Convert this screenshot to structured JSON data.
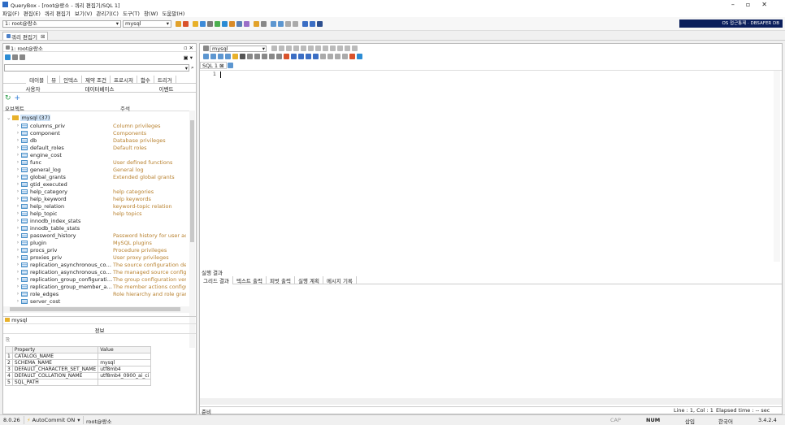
{
  "titlebar": {
    "title": "QueryBox - [root@랑소 - 쿼리 편집기/SQL 1]"
  },
  "menu": [
    "파일(F)",
    "편집(E)",
    "쿼리 편집기",
    "보기(V)",
    "관리기(C)",
    "도구(T)",
    "창(W)",
    "도움말(H)"
  ],
  "toolbar": {
    "connection": "1: root@랑소",
    "database": "mysql",
    "brand": "OS 접근통제 · DBSAFER DB"
  },
  "doc_tab": {
    "label": "쿼리 편집기"
  },
  "left": {
    "conn_label": "1: root@랑소",
    "tabs1": [
      "테이블",
      "뷰",
      "인덱스",
      "제약 조건",
      "프로시저",
      "함수",
      "트리거"
    ],
    "tabs2": [
      "사용자",
      "데이터베이스",
      "이벤트"
    ],
    "col_object": "오브젝트",
    "col_comment": "주석",
    "db_node": "mysql (37)",
    "tables": [
      {
        "name": "columns_priv",
        "comment": "Column privileges"
      },
      {
        "name": "component",
        "comment": "Components"
      },
      {
        "name": "db",
        "comment": "Database privileges"
      },
      {
        "name": "default_roles",
        "comment": "Default roles"
      },
      {
        "name": "engine_cost",
        "comment": ""
      },
      {
        "name": "func",
        "comment": "User defined functions"
      },
      {
        "name": "general_log",
        "comment": "General log"
      },
      {
        "name": "global_grants",
        "comment": "Extended global grants"
      },
      {
        "name": "gtid_executed",
        "comment": ""
      },
      {
        "name": "help_category",
        "comment": "help categories"
      },
      {
        "name": "help_keyword",
        "comment": "help keywords"
      },
      {
        "name": "help_relation",
        "comment": "keyword-topic relation"
      },
      {
        "name": "help_topic",
        "comment": "help topics"
      },
      {
        "name": "innodb_index_stats",
        "comment": ""
      },
      {
        "name": "innodb_table_stats",
        "comment": ""
      },
      {
        "name": "password_history",
        "comment": "Password history for user acc..."
      },
      {
        "name": "plugin",
        "comment": "MySQL plugins"
      },
      {
        "name": "procs_priv",
        "comment": "Procedure privileges"
      },
      {
        "name": "proxies_priv",
        "comment": "User proxy privileges"
      },
      {
        "name": "replication_asynchronous_connection...",
        "comment": "The source configuration detai"
      },
      {
        "name": "replication_asynchronous_connection...",
        "comment": "The managed source configura"
      },
      {
        "name": "replication_group_configuration_ver...",
        "comment": "The group configuration versic"
      },
      {
        "name": "replication_group_member_actions",
        "comment": "The member actions configura"
      },
      {
        "name": "role_edges",
        "comment": "Role hierarchy and role grants"
      },
      {
        "name": "server_cost",
        "comment": ""
      }
    ],
    "info_db": "mysql",
    "info_title": "정보",
    "prop_header": [
      "Property",
      "Value"
    ],
    "props": [
      {
        "n": "1",
        "p": "CATALOG_NAME",
        "v": ""
      },
      {
        "n": "2",
        "p": "SCHEMA_NAME",
        "v": "mysql"
      },
      {
        "n": "3",
        "p": "DEFAULT_CHARACTER_SET_NAME",
        "v": "utf8mb4"
      },
      {
        "n": "4",
        "p": "DEFAULT_COLLATION_NAME",
        "v": "utf8mb4_0900_ai_ci"
      },
      {
        "n": "5",
        "p": "SQL_PATH",
        "v": ""
      }
    ]
  },
  "editor": {
    "db": "mysql",
    "tab": "SQL 1",
    "line_no": "1"
  },
  "results": {
    "title": "실행 결과",
    "tabs": [
      "그리드 결과",
      "텍스트 출력",
      "피벗 출력",
      "실행 계획",
      "메시지 기록"
    ],
    "footer": "준비",
    "linecol": "Line : 1, Col : 1",
    "elapsed": "Elapsed time : -- sec"
  },
  "status": {
    "version": "8.0.26",
    "autocommit": "AutoCommit ON",
    "user": "root@랑소",
    "cap": "CAP",
    "num": "NUM",
    "ins": "삽입",
    "lang": "한국어",
    "app_ver": "3.4.2.4"
  }
}
